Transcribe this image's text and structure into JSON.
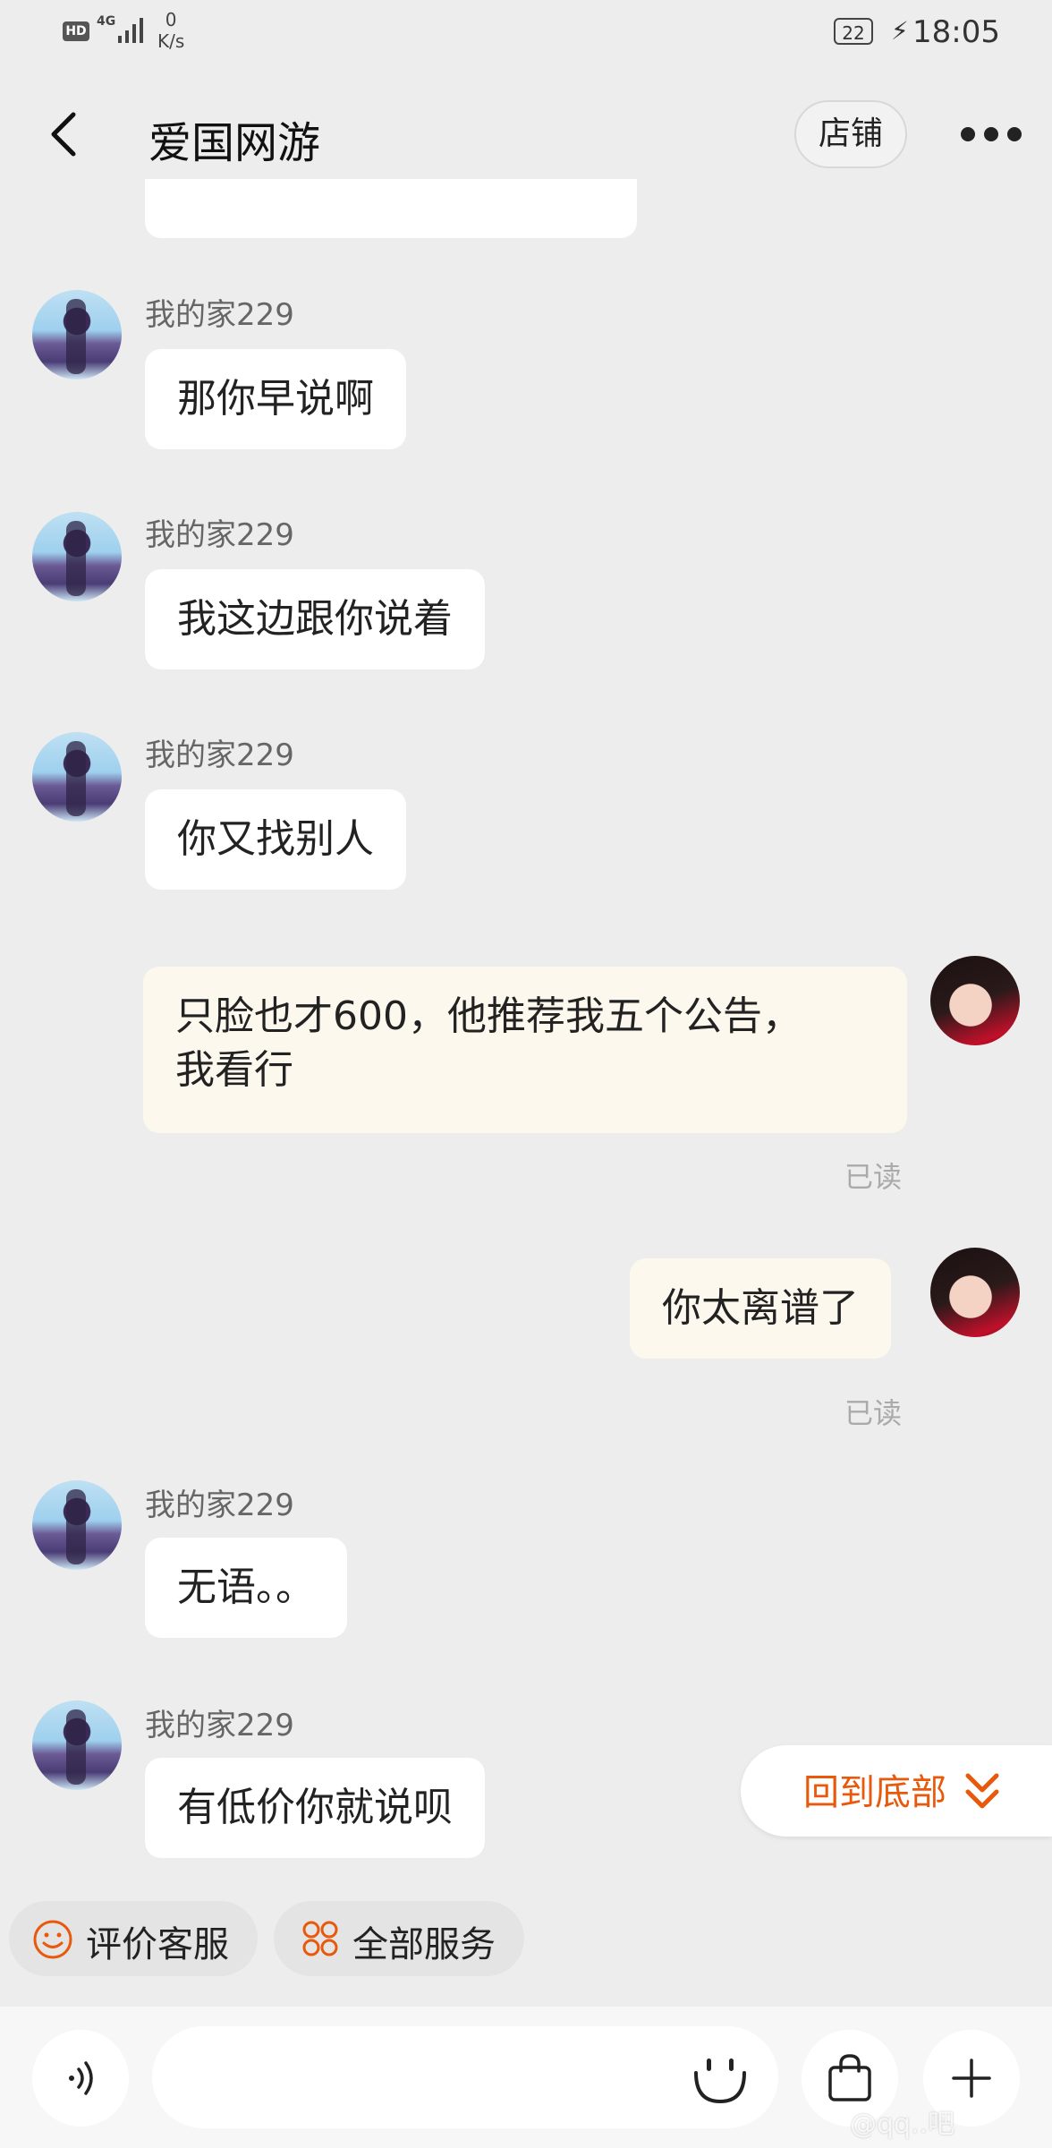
{
  "status_bar": {
    "hd": "HD",
    "network": "4G",
    "speed_value": "0",
    "speed_unit": "K/s",
    "battery": "22",
    "time": "18:05"
  },
  "header": {
    "title": "爱国网游",
    "store_label": "店铺"
  },
  "messages": [
    {
      "sender": "我的家229",
      "text": "那你早说啊",
      "direction": "in"
    },
    {
      "sender": "我的家229",
      "text": "我这边跟你说着",
      "direction": "in"
    },
    {
      "sender": "我的家229",
      "text": "你又找别人",
      "direction": "in"
    },
    {
      "text_line1": "只脸也才600，他推荐我五个公告，",
      "text_line2": "我看行",
      "direction": "out",
      "status": "已读"
    },
    {
      "text": "你太离谱了",
      "direction": "out",
      "status": "已读"
    },
    {
      "sender": "我的家229",
      "text": "无语。。",
      "direction": "in"
    },
    {
      "sender": "我的家229",
      "text": "有低价你就说呗",
      "direction": "in"
    }
  ],
  "back_to_bottom_label": "回到底部",
  "service_chips": [
    {
      "label": "评价客服",
      "icon": "smile-icon"
    },
    {
      "label": "全部服务",
      "icon": "grid-flower-icon"
    }
  ],
  "accent_color": "#e8590c",
  "watermark": "@qq..吧"
}
